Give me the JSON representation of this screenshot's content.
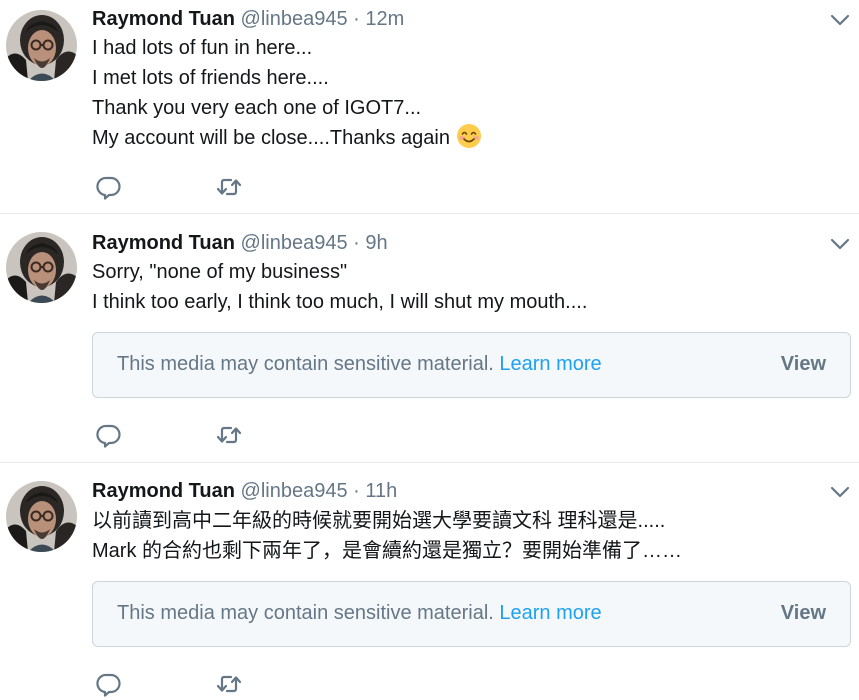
{
  "colors": {
    "text": "#14171a",
    "secondary": "#657786",
    "link": "#1da1f2",
    "divider": "#e6ecf0",
    "media_bg": "#f5f8fa"
  },
  "icons": {
    "reply": "reply-icon",
    "retweet": "retweet-icon",
    "caret": "chevron-down-icon",
    "emoji": "smiling-face-emoji"
  },
  "tweets": [
    {
      "name": "Raymond Tuan",
      "handle": "@linbea945",
      "separator": "·",
      "time": "12m",
      "lines": [
        "I had lots of fun in here...",
        "I met lots of friends here....",
        "Thank you very each one of IGOT7...",
        "My account will be close....Thanks again"
      ]
    },
    {
      "name": "Raymond Tuan",
      "handle": "@linbea945",
      "separator": "·",
      "time": "9h",
      "lines": [
        "Sorry, \"none of my business\"",
        "I think too early, I think too much, I will shut my mouth...."
      ],
      "media_warning": {
        "text": "This media may contain sensitive material.",
        "link": "Learn more",
        "action": "View"
      }
    },
    {
      "name": "Raymond Tuan",
      "handle": "@linbea945",
      "separator": "·",
      "time": "11h",
      "lines": [
        "以前讀到高中二年級的時候就要開始選大學要讀文科 理科還是.....",
        "Mark 的合約也剩下兩年了，是會續約還是獨立？要開始準備了……"
      ],
      "media_warning": {
        "text": "This media may contain sensitive material.",
        "link": "Learn more",
        "action": "View"
      }
    }
  ]
}
